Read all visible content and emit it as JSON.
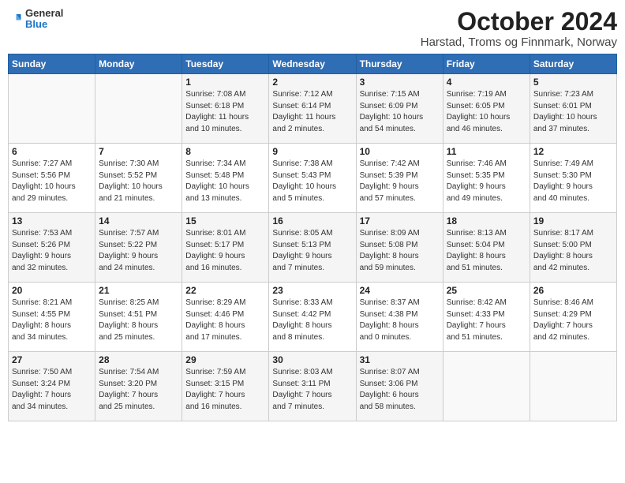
{
  "header": {
    "logo_line1": "General",
    "logo_line2": "Blue",
    "title": "October 2024",
    "subtitle": "Harstad, Troms og Finnmark, Norway"
  },
  "weekdays": [
    "Sunday",
    "Monday",
    "Tuesday",
    "Wednesday",
    "Thursday",
    "Friday",
    "Saturday"
  ],
  "weeks": [
    [
      {
        "day": "",
        "info": ""
      },
      {
        "day": "",
        "info": ""
      },
      {
        "day": "1",
        "info": "Sunrise: 7:08 AM\nSunset: 6:18 PM\nDaylight: 11 hours\nand 10 minutes."
      },
      {
        "day": "2",
        "info": "Sunrise: 7:12 AM\nSunset: 6:14 PM\nDaylight: 11 hours\nand 2 minutes."
      },
      {
        "day": "3",
        "info": "Sunrise: 7:15 AM\nSunset: 6:09 PM\nDaylight: 10 hours\nand 54 minutes."
      },
      {
        "day": "4",
        "info": "Sunrise: 7:19 AM\nSunset: 6:05 PM\nDaylight: 10 hours\nand 46 minutes."
      },
      {
        "day": "5",
        "info": "Sunrise: 7:23 AM\nSunset: 6:01 PM\nDaylight: 10 hours\nand 37 minutes."
      }
    ],
    [
      {
        "day": "6",
        "info": "Sunrise: 7:27 AM\nSunset: 5:56 PM\nDaylight: 10 hours\nand 29 minutes."
      },
      {
        "day": "7",
        "info": "Sunrise: 7:30 AM\nSunset: 5:52 PM\nDaylight: 10 hours\nand 21 minutes."
      },
      {
        "day": "8",
        "info": "Sunrise: 7:34 AM\nSunset: 5:48 PM\nDaylight: 10 hours\nand 13 minutes."
      },
      {
        "day": "9",
        "info": "Sunrise: 7:38 AM\nSunset: 5:43 PM\nDaylight: 10 hours\nand 5 minutes."
      },
      {
        "day": "10",
        "info": "Sunrise: 7:42 AM\nSunset: 5:39 PM\nDaylight: 9 hours\nand 57 minutes."
      },
      {
        "day": "11",
        "info": "Sunrise: 7:46 AM\nSunset: 5:35 PM\nDaylight: 9 hours\nand 49 minutes."
      },
      {
        "day": "12",
        "info": "Sunrise: 7:49 AM\nSunset: 5:30 PM\nDaylight: 9 hours\nand 40 minutes."
      }
    ],
    [
      {
        "day": "13",
        "info": "Sunrise: 7:53 AM\nSunset: 5:26 PM\nDaylight: 9 hours\nand 32 minutes."
      },
      {
        "day": "14",
        "info": "Sunrise: 7:57 AM\nSunset: 5:22 PM\nDaylight: 9 hours\nand 24 minutes."
      },
      {
        "day": "15",
        "info": "Sunrise: 8:01 AM\nSunset: 5:17 PM\nDaylight: 9 hours\nand 16 minutes."
      },
      {
        "day": "16",
        "info": "Sunrise: 8:05 AM\nSunset: 5:13 PM\nDaylight: 9 hours\nand 7 minutes."
      },
      {
        "day": "17",
        "info": "Sunrise: 8:09 AM\nSunset: 5:08 PM\nDaylight: 8 hours\nand 59 minutes."
      },
      {
        "day": "18",
        "info": "Sunrise: 8:13 AM\nSunset: 5:04 PM\nDaylight: 8 hours\nand 51 minutes."
      },
      {
        "day": "19",
        "info": "Sunrise: 8:17 AM\nSunset: 5:00 PM\nDaylight: 8 hours\nand 42 minutes."
      }
    ],
    [
      {
        "day": "20",
        "info": "Sunrise: 8:21 AM\nSunset: 4:55 PM\nDaylight: 8 hours\nand 34 minutes."
      },
      {
        "day": "21",
        "info": "Sunrise: 8:25 AM\nSunset: 4:51 PM\nDaylight: 8 hours\nand 25 minutes."
      },
      {
        "day": "22",
        "info": "Sunrise: 8:29 AM\nSunset: 4:46 PM\nDaylight: 8 hours\nand 17 minutes."
      },
      {
        "day": "23",
        "info": "Sunrise: 8:33 AM\nSunset: 4:42 PM\nDaylight: 8 hours\nand 8 minutes."
      },
      {
        "day": "24",
        "info": "Sunrise: 8:37 AM\nSunset: 4:38 PM\nDaylight: 8 hours\nand 0 minutes."
      },
      {
        "day": "25",
        "info": "Sunrise: 8:42 AM\nSunset: 4:33 PM\nDaylight: 7 hours\nand 51 minutes."
      },
      {
        "day": "26",
        "info": "Sunrise: 8:46 AM\nSunset: 4:29 PM\nDaylight: 7 hours\nand 42 minutes."
      }
    ],
    [
      {
        "day": "27",
        "info": "Sunrise: 7:50 AM\nSunset: 3:24 PM\nDaylight: 7 hours\nand 34 minutes."
      },
      {
        "day": "28",
        "info": "Sunrise: 7:54 AM\nSunset: 3:20 PM\nDaylight: 7 hours\nand 25 minutes."
      },
      {
        "day": "29",
        "info": "Sunrise: 7:59 AM\nSunset: 3:15 PM\nDaylight: 7 hours\nand 16 minutes."
      },
      {
        "day": "30",
        "info": "Sunrise: 8:03 AM\nSunset: 3:11 PM\nDaylight: 7 hours\nand 7 minutes."
      },
      {
        "day": "31",
        "info": "Sunrise: 8:07 AM\nSunset: 3:06 PM\nDaylight: 6 hours\nand 58 minutes."
      },
      {
        "day": "",
        "info": ""
      },
      {
        "day": "",
        "info": ""
      }
    ]
  ]
}
